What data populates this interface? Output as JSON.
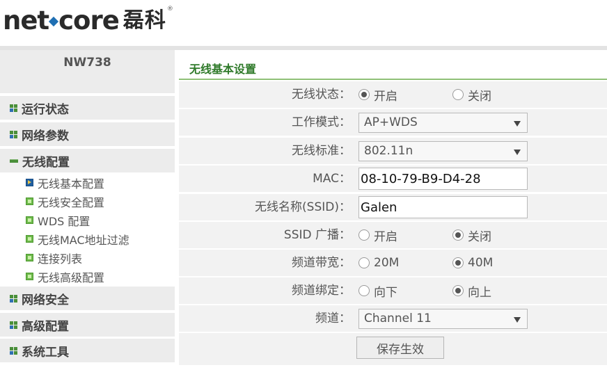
{
  "brand": {
    "name": "netcore",
    "name_part1": "net",
    "name_part2": "core",
    "name_cn": "磊科",
    "registered": "®",
    "dot_color": "#1f6fb3"
  },
  "sidebar": {
    "model": "NW738",
    "items": [
      {
        "label": "运行状态"
      },
      {
        "label": "网络参数"
      },
      {
        "label": "无线配置",
        "expanded": true
      },
      {
        "label": "网络安全"
      },
      {
        "label": "高级配置"
      },
      {
        "label": "系统工具"
      }
    ],
    "wireless_sub": [
      {
        "label": "无线基本配置",
        "active": true
      },
      {
        "label": "无线安全配置"
      },
      {
        "label": "WDS 配置"
      },
      {
        "label": "无线MAC地址过滤"
      },
      {
        "label": "连接列表"
      },
      {
        "label": "无线高级配置"
      }
    ]
  },
  "main": {
    "title": "无线基本设置",
    "fields": {
      "wireless_status": {
        "label": "无线状态：",
        "options": [
          "开启",
          "关闭"
        ],
        "selected": "开启"
      },
      "work_mode": {
        "label": "工作模式：",
        "value": "AP+WDS"
      },
      "wireless_standard": {
        "label": "无线标准：",
        "value": "802.11n"
      },
      "mac": {
        "label": "MAC：",
        "value": "08-10-79-B9-D4-28"
      },
      "ssid": {
        "label": "无线名称(SSID)：",
        "value": "Galen"
      },
      "ssid_broadcast": {
        "label": "SSID 广播：",
        "options": [
          "开启",
          "关闭"
        ],
        "selected": "关闭"
      },
      "bandwidth": {
        "label": "频道带宽：",
        "options": [
          "20M",
          "40M"
        ],
        "selected": "40M"
      },
      "channel_bind": {
        "label": "频道绑定：",
        "options": [
          "向下",
          "向上"
        ],
        "selected": "向上"
      },
      "channel": {
        "label": "频道：",
        "value": "Channel 11"
      }
    },
    "save_label": "保存生效"
  },
  "colors": {
    "accent_green": "#2f7a2a",
    "title_border": "#8fc077",
    "row_bg": "#f2f2f2",
    "sidebar_bg": "#ececec"
  }
}
